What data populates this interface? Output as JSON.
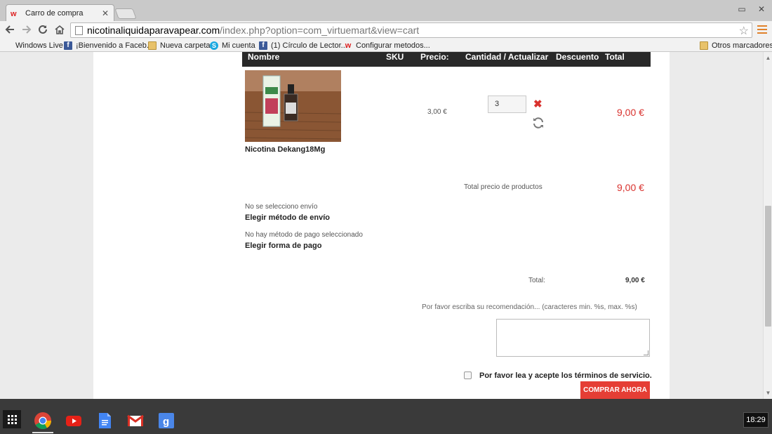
{
  "browser": {
    "tab_title": "Carro de compra",
    "url_host": "nicotinaliquidaparavapear.com",
    "url_path": "/index.php?option=com_virtuemart&view=cart",
    "bookmarks": [
      "Windows Live",
      "¡Bienvenido a Faceb...",
      "Nueva carpeta",
      "Mi cuenta",
      "(1) Círculo de Lector...",
      "Configurar metodos...",
      "Otros marcadores"
    ]
  },
  "cart": {
    "columns": {
      "name": "Nombre",
      "sku": "SKU",
      "price": "Precio:",
      "quantity": "Cantidad / Actualizar",
      "discount": "Descuento",
      "total": "Total"
    },
    "item": {
      "name": "Nicotina Dekang18Mg",
      "price": "3,00 €",
      "quantity": "3",
      "total": "9,00 €",
      "image_label": "Vapor Fiesta"
    },
    "products_total_label": "Total precio de productos",
    "products_total": "9,00 €",
    "shipping_status": "No se selecciono envío",
    "shipping_link": "Elegir método de envío",
    "payment_status": "No hay método de pago seleccionado",
    "payment_link": "Elegir forma de pago",
    "grand_total_label": "Total:",
    "grand_total": "9,00 €",
    "comment_label": "Por favor escriba su recomendación... (caracteres min. %s, max. %s)",
    "tos_label": "Por favor lea y acepte los términos de servicio.",
    "checkout_button": "COMPRAR AHORA"
  },
  "shelf": {
    "clock": "18:29",
    "apps": [
      "chrome-icon",
      "youtube-icon",
      "docs-icon",
      "gmail-icon",
      "google-icon"
    ]
  },
  "colors": {
    "accent_red": "#d9322e",
    "header_bg": "#292929",
    "button_red": "#e53e35"
  }
}
